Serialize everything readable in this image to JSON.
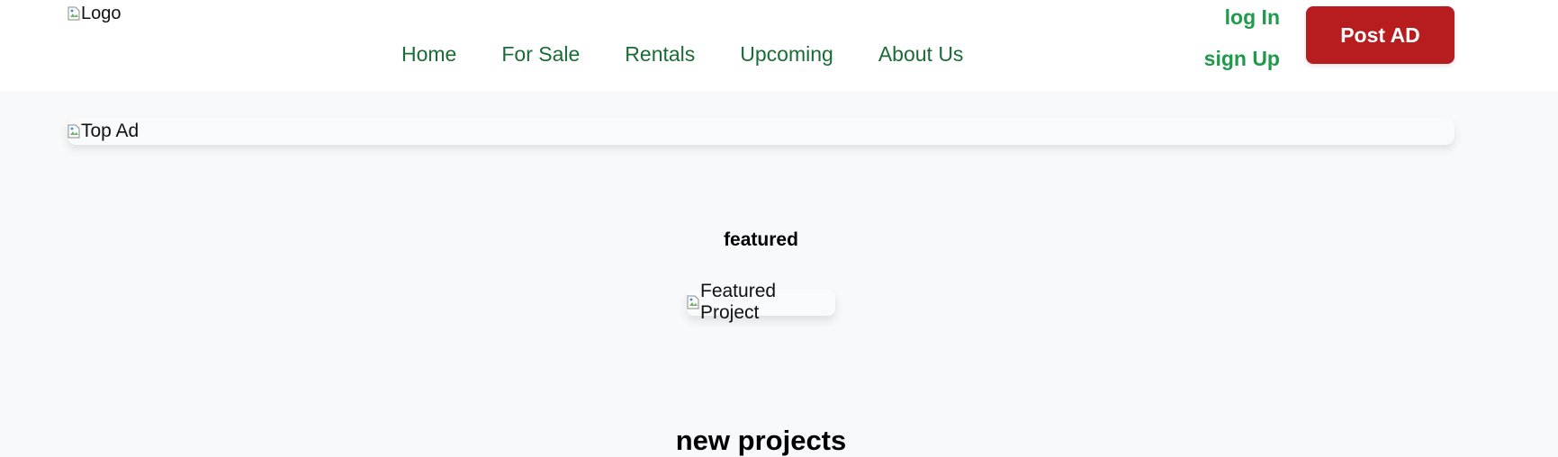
{
  "header": {
    "logo_alt": "Logo",
    "nav": [
      {
        "label": "Home"
      },
      {
        "label": "For Sale"
      },
      {
        "label": "Rentals"
      },
      {
        "label": "Upcoming"
      },
      {
        "label": "About Us"
      }
    ],
    "login_label": "log In",
    "signup_label": "sign Up",
    "post_ad_label": "Post AD"
  },
  "main": {
    "top_ad_alt": "Top Ad",
    "featured_heading": "featured",
    "featured_project_alt": "Featured Project",
    "new_projects_heading": "new projects"
  },
  "colors": {
    "nav_text": "#1b6b36",
    "auth_text": "#1f9a4b",
    "post_ad_bg": "#b71c1f",
    "page_bg": "#f8f9fb"
  }
}
